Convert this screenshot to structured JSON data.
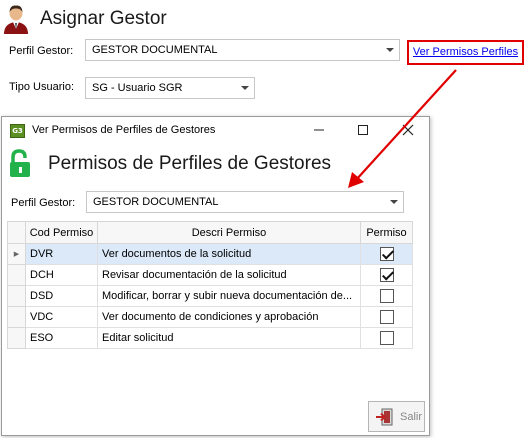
{
  "main_form": {
    "title": "Asignar Gestor",
    "perfil_label": "Perfil Gestor:",
    "perfil_value": "GESTOR DOCUMENTAL",
    "tipo_label": "Tipo Usuario:",
    "tipo_value": "SG - Usuario SGR",
    "link_text": "Ver Permisos Perfiles"
  },
  "dialog": {
    "app_icon_text": "G3",
    "window_title": "Ver Permisos de Perfiles de Gestores",
    "heading": "Permisos de Perfiles de Gestores",
    "perfil_label": "Perfil Gestor:",
    "perfil_value": "GESTOR DOCUMENTAL",
    "columns": {
      "code": "Cod Permiso",
      "desc": "Descri Permiso",
      "perm": "Permiso"
    },
    "rows": [
      {
        "code": "DVR",
        "desc": "Ver documentos de la solicitud",
        "checked": true,
        "selected": true
      },
      {
        "code": "DCH",
        "desc": "Revisar documentación de la solicitud",
        "checked": true,
        "selected": false
      },
      {
        "code": "DSD",
        "desc": "Modificar, borrar y subir nueva documentación de...",
        "checked": false,
        "selected": false
      },
      {
        "code": "VDC",
        "desc": "Ver documento de condiciones y aprobación",
        "checked": false,
        "selected": false
      },
      {
        "code": "ESO",
        "desc": "Editar solicitud",
        "checked": false,
        "selected": false
      }
    ],
    "salir_label": "Salir"
  },
  "icons": [
    "user-icon",
    "lock-open-icon",
    "exit-icon",
    "chevron-down-icon",
    "row-indicator-icon"
  ],
  "colors": {
    "annotation_red": "#e00000",
    "link_blue": "#0000ee",
    "lock_green": "#22b24c",
    "selected_row": "#dbe9f9"
  }
}
